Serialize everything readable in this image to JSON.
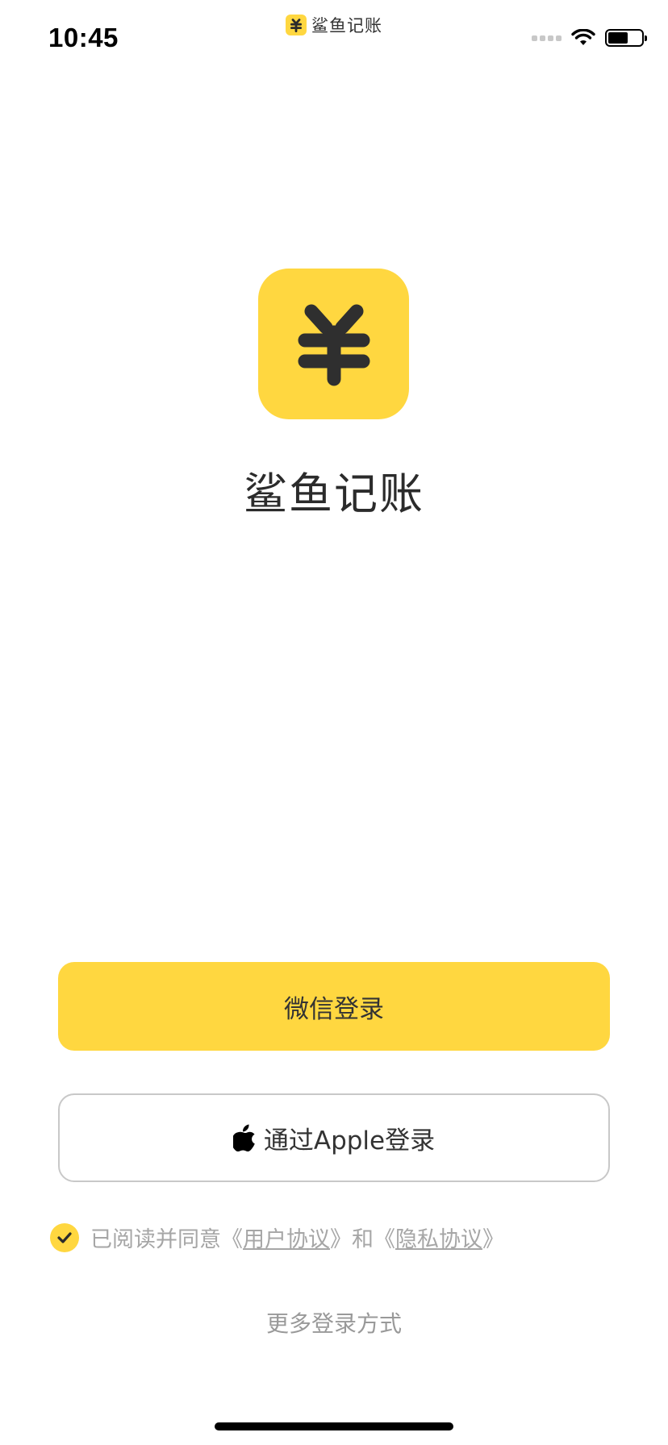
{
  "status_bar": {
    "time": "10:45",
    "app_name": "鲨鱼记账",
    "icons": [
      "cellular-signal-icon",
      "wifi-icon",
      "battery-icon"
    ]
  },
  "app": {
    "logo_symbol": "羊",
    "name": "鲨鱼记账",
    "brand_color": "#FFD740"
  },
  "login": {
    "wechat_label": "微信登录",
    "apple_label": "通过Apple登录"
  },
  "agreement": {
    "checked": true,
    "prefix": "已阅读并同意",
    "open_quote_1": "《",
    "user_agreement": "用户协议",
    "close_quote_1": "》",
    "conjunction": "和",
    "open_quote_2": "《",
    "privacy_policy": "隐私协议",
    "close_quote_2": "》"
  },
  "more_login_label": "更多登录方式"
}
